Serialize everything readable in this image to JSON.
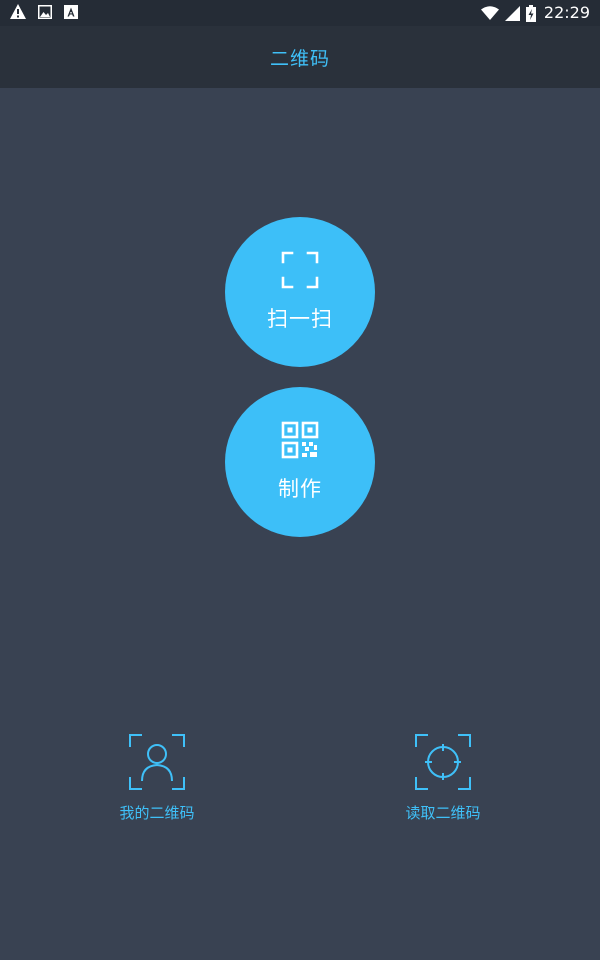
{
  "status_bar": {
    "time": "22:29",
    "left_icons": [
      "warning-icon",
      "image-icon",
      "text-a-icon"
    ],
    "right_icons": [
      "wifi-icon",
      "signal-icon",
      "battery-icon"
    ]
  },
  "app_bar": {
    "title": "二维码"
  },
  "actions": {
    "scan": {
      "label": "扫一扫",
      "icon": "scan-frame-icon"
    },
    "make": {
      "label": "制作",
      "icon": "qr-code-icon"
    }
  },
  "bottom": {
    "my_qr": {
      "label": "我的二维码",
      "icon": "user-frame-icon"
    },
    "read_qr": {
      "label": "读取二维码",
      "icon": "target-frame-icon"
    }
  },
  "colors": {
    "accent": "#3dbff8",
    "background": "#394252",
    "app_bar": "#2a313b",
    "status_bar": "#252c36"
  }
}
